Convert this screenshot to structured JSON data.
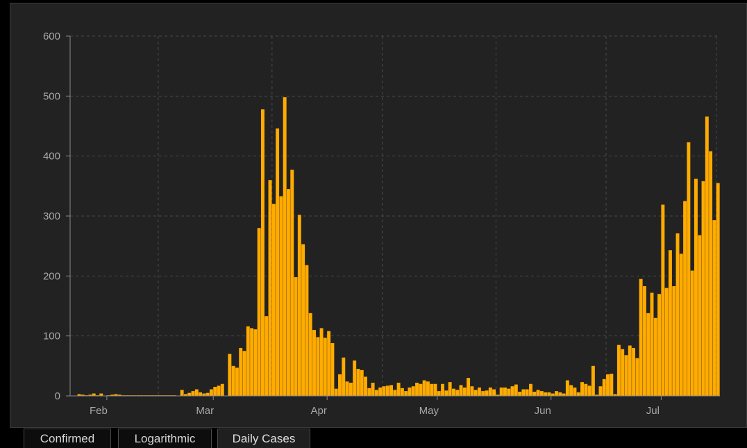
{
  "colors": {
    "background": "#000000",
    "panel": "#222222",
    "bar": "#ffab00",
    "grid": "#4a4a4a",
    "axis": "#8a8a8a",
    "tick_text": "#a8a8a8"
  },
  "tabs": [
    {
      "label": "Confirmed",
      "active": false
    },
    {
      "label": "Logarithmic",
      "active": false
    },
    {
      "label": "Daily Cases",
      "active": true
    }
  ],
  "chart_data": {
    "type": "bar",
    "title": "",
    "xlabel": "",
    "ylabel": "",
    "ylim": [
      0,
      600
    ],
    "yticks": [
      0,
      100,
      200,
      300,
      400,
      500,
      600
    ],
    "xticks": [
      {
        "label": "Feb",
        "x": "2020-02-01"
      },
      {
        "label": "Mar",
        "x": "2020-03-01"
      },
      {
        "label": "Apr",
        "x": "2020-04-01"
      },
      {
        "label": "May",
        "x": "2020-05-01"
      },
      {
        "label": "Jun",
        "x": "2020-06-01"
      },
      {
        "label": "Jul",
        "x": "2020-07-01"
      }
    ],
    "grid": true,
    "series": [
      {
        "start_date": "2020-01-22",
        "values": [
          0,
          0,
          3,
          2,
          1,
          2,
          4,
          1,
          4,
          0,
          1,
          2,
          3,
          2,
          1,
          1,
          1,
          1,
          1,
          1,
          1,
          1,
          1,
          1,
          1,
          1,
          1,
          1,
          1,
          0,
          10,
          3,
          5,
          8,
          11,
          6,
          4,
          5,
          11,
          15,
          17,
          20,
          0,
          70,
          50,
          47,
          80,
          75,
          116,
          113,
          111,
          280,
          478,
          133,
          360,
          320,
          446,
          333,
          498,
          345,
          377,
          198,
          302,
          253,
          218,
          138,
          110,
          98,
          113,
          97,
          108,
          88,
          12,
          36,
          64,
          24,
          22,
          59,
          45,
          43,
          32,
          13,
          22,
          10,
          14,
          16,
          17,
          18,
          10,
          22,
          13,
          8,
          14,
          16,
          22,
          20,
          26,
          24,
          20,
          20,
          8,
          20,
          9,
          23,
          12,
          10,
          18,
          14,
          30,
          16,
          10,
          14,
          8,
          9,
          14,
          11,
          2,
          14,
          14,
          12,
          16,
          19,
          7,
          11,
          11,
          20,
          7,
          10,
          8,
          6,
          6,
          4,
          8,
          6,
          4,
          26,
          18,
          14,
          6,
          23,
          20,
          17,
          50,
          2,
          16,
          28,
          36,
          37,
          3,
          85,
          78,
          68,
          84,
          80,
          63,
          195,
          183,
          138,
          172,
          130,
          170,
          319,
          180,
          243,
          183,
          271,
          237,
          325,
          423,
          209,
          362,
          268,
          358,
          466,
          408,
          293,
          355
        ]
      }
    ]
  }
}
